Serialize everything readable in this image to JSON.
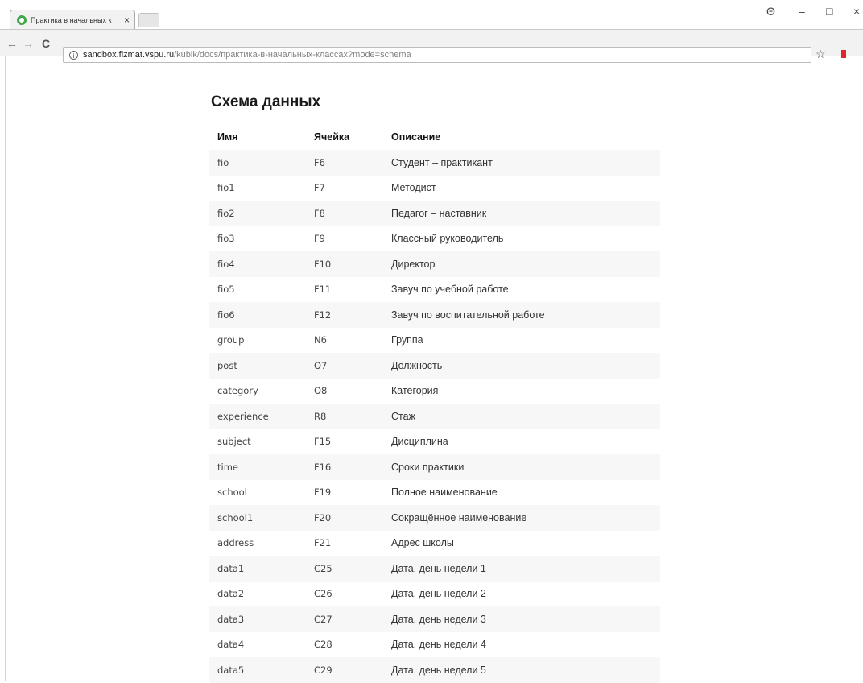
{
  "browser": {
    "tab_title": "Практика в начальных к",
    "tab_close": "×",
    "url_host": "sandbox.fizmat.vspu.ru",
    "url_path": "/kubik/docs/практика-в-начальных-классах?mode=schema",
    "info_glyph": "i",
    "back_glyph": "←",
    "forward_glyph": "→",
    "reload_glyph": "C",
    "star_glyph": "☆",
    "menu_glyph": "⋮",
    "profile_glyph": "Θ",
    "minimize_glyph": "–",
    "maximize_glyph": "□",
    "close_glyph": "×"
  },
  "page": {
    "title": "Схема данных",
    "columns": [
      "Имя",
      "Ячейка",
      "Описание"
    ],
    "rows": [
      [
        "fio",
        "F6",
        "Студент – практикант"
      ],
      [
        "fio1",
        "F7",
        "Методист"
      ],
      [
        "fio2",
        "F8",
        "Педагог – наставник"
      ],
      [
        "fio3",
        "F9",
        "Классный руководитель"
      ],
      [
        "fio4",
        "F10",
        "Директор"
      ],
      [
        "fio5",
        "F11",
        "Завуч по учебной работе"
      ],
      [
        "fio6",
        "F12",
        "Завуч по воспитательной работе"
      ],
      [
        "group",
        "N6",
        "Группа"
      ],
      [
        "post",
        "O7",
        "Должность"
      ],
      [
        "category",
        "O8",
        "Категория"
      ],
      [
        "experience",
        "R8",
        "Стаж"
      ],
      [
        "subject",
        "F15",
        "Дисциплина"
      ],
      [
        "time",
        "F16",
        "Сроки практики"
      ],
      [
        "school",
        "F19",
        "Полное наименование"
      ],
      [
        "school1",
        "F20",
        "Сокращённое наименование"
      ],
      [
        "address",
        "F21",
        "Адрес школы"
      ],
      [
        "data1",
        "C25",
        "Дата, день недели 1"
      ],
      [
        "data2",
        "C26",
        "Дата, день недели 2"
      ],
      [
        "data3",
        "C27",
        "Дата, день недели 3"
      ],
      [
        "data4",
        "C28",
        "Дата, день недели 4"
      ],
      [
        "data5",
        "C29",
        "Дата, день недели 5"
      ]
    ]
  },
  "colors": {
    "favicon": "#3ea84a",
    "bookmark": "#e0262d",
    "row_stripe": "#f7f7f7"
  }
}
